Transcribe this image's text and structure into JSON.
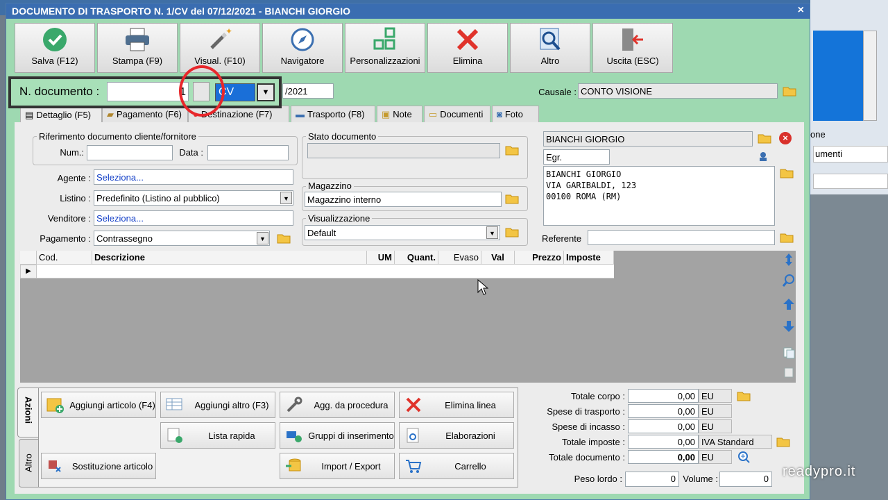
{
  "window": {
    "title": "DOCUMENTO DI TRASPORTO N. 1/CV del 07/12/2021 - BIANCHI GIORGIO",
    "close": "×"
  },
  "toolbar": [
    {
      "label": "Salva (F12)",
      "icon": "check-icon"
    },
    {
      "label": "Stampa (F9)",
      "icon": "printer-icon"
    },
    {
      "label": "Visual. (F10)",
      "icon": "magic-wand-icon"
    },
    {
      "label": "Navigatore",
      "icon": "compass-icon"
    },
    {
      "label": "Personalizzazioni",
      "icon": "grid-squares-icon"
    },
    {
      "label": "Elimina",
      "icon": "delete-x-icon"
    },
    {
      "label": "Altro",
      "icon": "magnifier-icon"
    },
    {
      "label": "Uscita (ESC)",
      "icon": "exit-door-icon"
    }
  ],
  "doc_number": {
    "label": "N. documento :",
    "number": "1",
    "series": "CV",
    "date": "/2021"
  },
  "causale": {
    "label": "Causale :",
    "value": "CONTO VISIONE"
  },
  "tabs": [
    "Dettaglio (F5)",
    "Pagamento (F6)",
    "Destinazione (F7)",
    "Trasporto (F8)",
    "Note",
    "Documenti",
    "Foto"
  ],
  "riferimento": {
    "title": "Riferimento documento cliente/fornitore",
    "num_label": "Num.:",
    "data_label": "Data :"
  },
  "agente": {
    "label": "Agente :",
    "value": "Seleziona..."
  },
  "listino": {
    "label": "Listino :",
    "value": "Predefinito (Listino al pubblico)"
  },
  "venditore": {
    "label": "Venditore :",
    "value": "Seleziona..."
  },
  "pagamento": {
    "label": "Pagamento :",
    "value": "Contrassegno"
  },
  "stato": {
    "title": "Stato documento",
    "value": ""
  },
  "magazzino": {
    "title": "Magazzino",
    "value": "Magazzino interno"
  },
  "visualizzazione": {
    "title": "Visualizzazione",
    "value": "Default"
  },
  "cliente": {
    "name": "BIANCHI GIORGIO",
    "title": "Egr.",
    "address_lines": [
      "BIANCHI GIORGIO",
      "VIA GARIBALDI, 123",
      "00100 ROMA (RM)"
    ],
    "referente_label": "Referente"
  },
  "grid": {
    "columns": [
      "Cod.",
      "Descrizione",
      "UM",
      "Quant.",
      "Evaso",
      "Val",
      "Prezzo",
      "Imposte"
    ]
  },
  "side_tabs": [
    "Azioni",
    "Altro"
  ],
  "actions": [
    {
      "label": "Aggiungi articolo (F4)",
      "icon": "add-article-icon"
    },
    {
      "label": "Aggiungi altro (F3)",
      "icon": "table-add-icon"
    },
    {
      "label": "Agg. da procedura",
      "icon": "wrench-icon"
    },
    {
      "label": "Elimina linea",
      "icon": "delete-x-icon"
    },
    {
      "label": "Lista rapida",
      "icon": "quick-list-icon"
    },
    {
      "label": "Gruppi di inserimento",
      "icon": "group-insert-icon"
    },
    {
      "label": "Elaborazioni",
      "icon": "gear-doc-icon"
    },
    {
      "label": "Sostituzione articolo",
      "icon": "replace-icon"
    },
    {
      "label": "Import / Export",
      "icon": "import-export-icon"
    },
    {
      "label": "Carrello",
      "icon": "cart-icon"
    }
  ],
  "totals": [
    {
      "label": "Totale corpo :",
      "value": "0,00",
      "unit": "EU"
    },
    {
      "label": "Spese di trasporto :",
      "value": "0,00",
      "unit": "EU"
    },
    {
      "label": "Spese di incasso :",
      "value": "0,00",
      "unit": "EU"
    },
    {
      "label": "Totale imposte :",
      "value": "0,00",
      "unit": "IVA Standard"
    },
    {
      "label": "Totale documento :",
      "value": "0,00",
      "unit": "EU"
    }
  ],
  "peso": {
    "label": "Peso lordo :",
    "value": "0"
  },
  "volume": {
    "label": "Volume :",
    "value": "0"
  },
  "background": {
    "label": "one",
    "field": "umenti"
  },
  "watermark": "readypro.it"
}
